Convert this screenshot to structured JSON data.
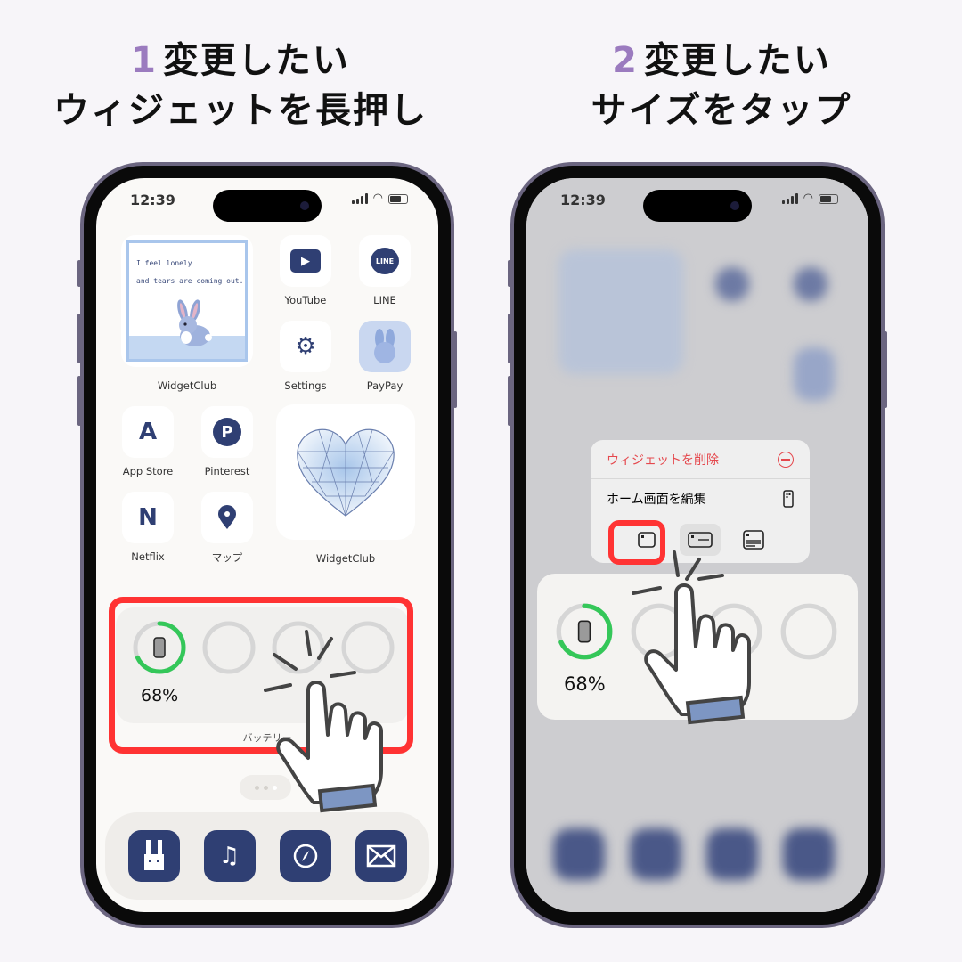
{
  "headings": [
    {
      "num": "1",
      "line1": "変更したい",
      "line2": "ウィジェットを長押し"
    },
    {
      "num": "2",
      "line1": "変更したい",
      "line2": "サイズをタップ"
    }
  ],
  "status": {
    "time": "12:39"
  },
  "home": {
    "rabbit_widget": {
      "line1": "I feel lonely",
      "line2": "and tears are coming out.",
      "label": "WidgetClub"
    },
    "apps": [
      {
        "label": "YouTube",
        "icon": "youtube-icon",
        "glyph": "▶"
      },
      {
        "label": "LINE",
        "icon": "line-icon",
        "glyph": "LINE"
      },
      {
        "label": "Settings",
        "icon": "settings-gear-icon",
        "glyph": "⚙"
      },
      {
        "label": "PayPay",
        "icon": "paypay-rabbit-icon",
        "glyph": "🐰"
      },
      {
        "label": "App Store",
        "icon": "app-store-icon",
        "glyph": "A"
      },
      {
        "label": "Pinterest",
        "icon": "pinterest-icon",
        "glyph": "P"
      },
      {
        "label": "Netflix",
        "icon": "netflix-icon",
        "glyph": "N"
      },
      {
        "label": "マップ",
        "icon": "maps-pin-icon",
        "glyph": "●"
      }
    ],
    "heart_widget": {
      "label": "WidgetClub"
    },
    "battery_widget": {
      "percent": "68%",
      "level": 0.68,
      "label": "バッテリー"
    },
    "dock": [
      {
        "icon": "rabbit-icon",
        "glyph": "🐰"
      },
      {
        "icon": "music-icon",
        "glyph": "♫"
      },
      {
        "icon": "safari-compass-icon",
        "glyph": "⊘"
      },
      {
        "icon": "mail-icon",
        "glyph": "✉"
      }
    ]
  },
  "context_menu": {
    "remove_widget": "ウィジェットを削除",
    "edit_home": "ホーム画面を編集",
    "sizes": [
      "small",
      "medium",
      "large"
    ],
    "selected_size": "small"
  },
  "colors": {
    "accent_purple": "#9b7bbf",
    "highlight_red": "#ff3333",
    "app_navy": "#2f3f73",
    "battery_green": "#34c759"
  }
}
